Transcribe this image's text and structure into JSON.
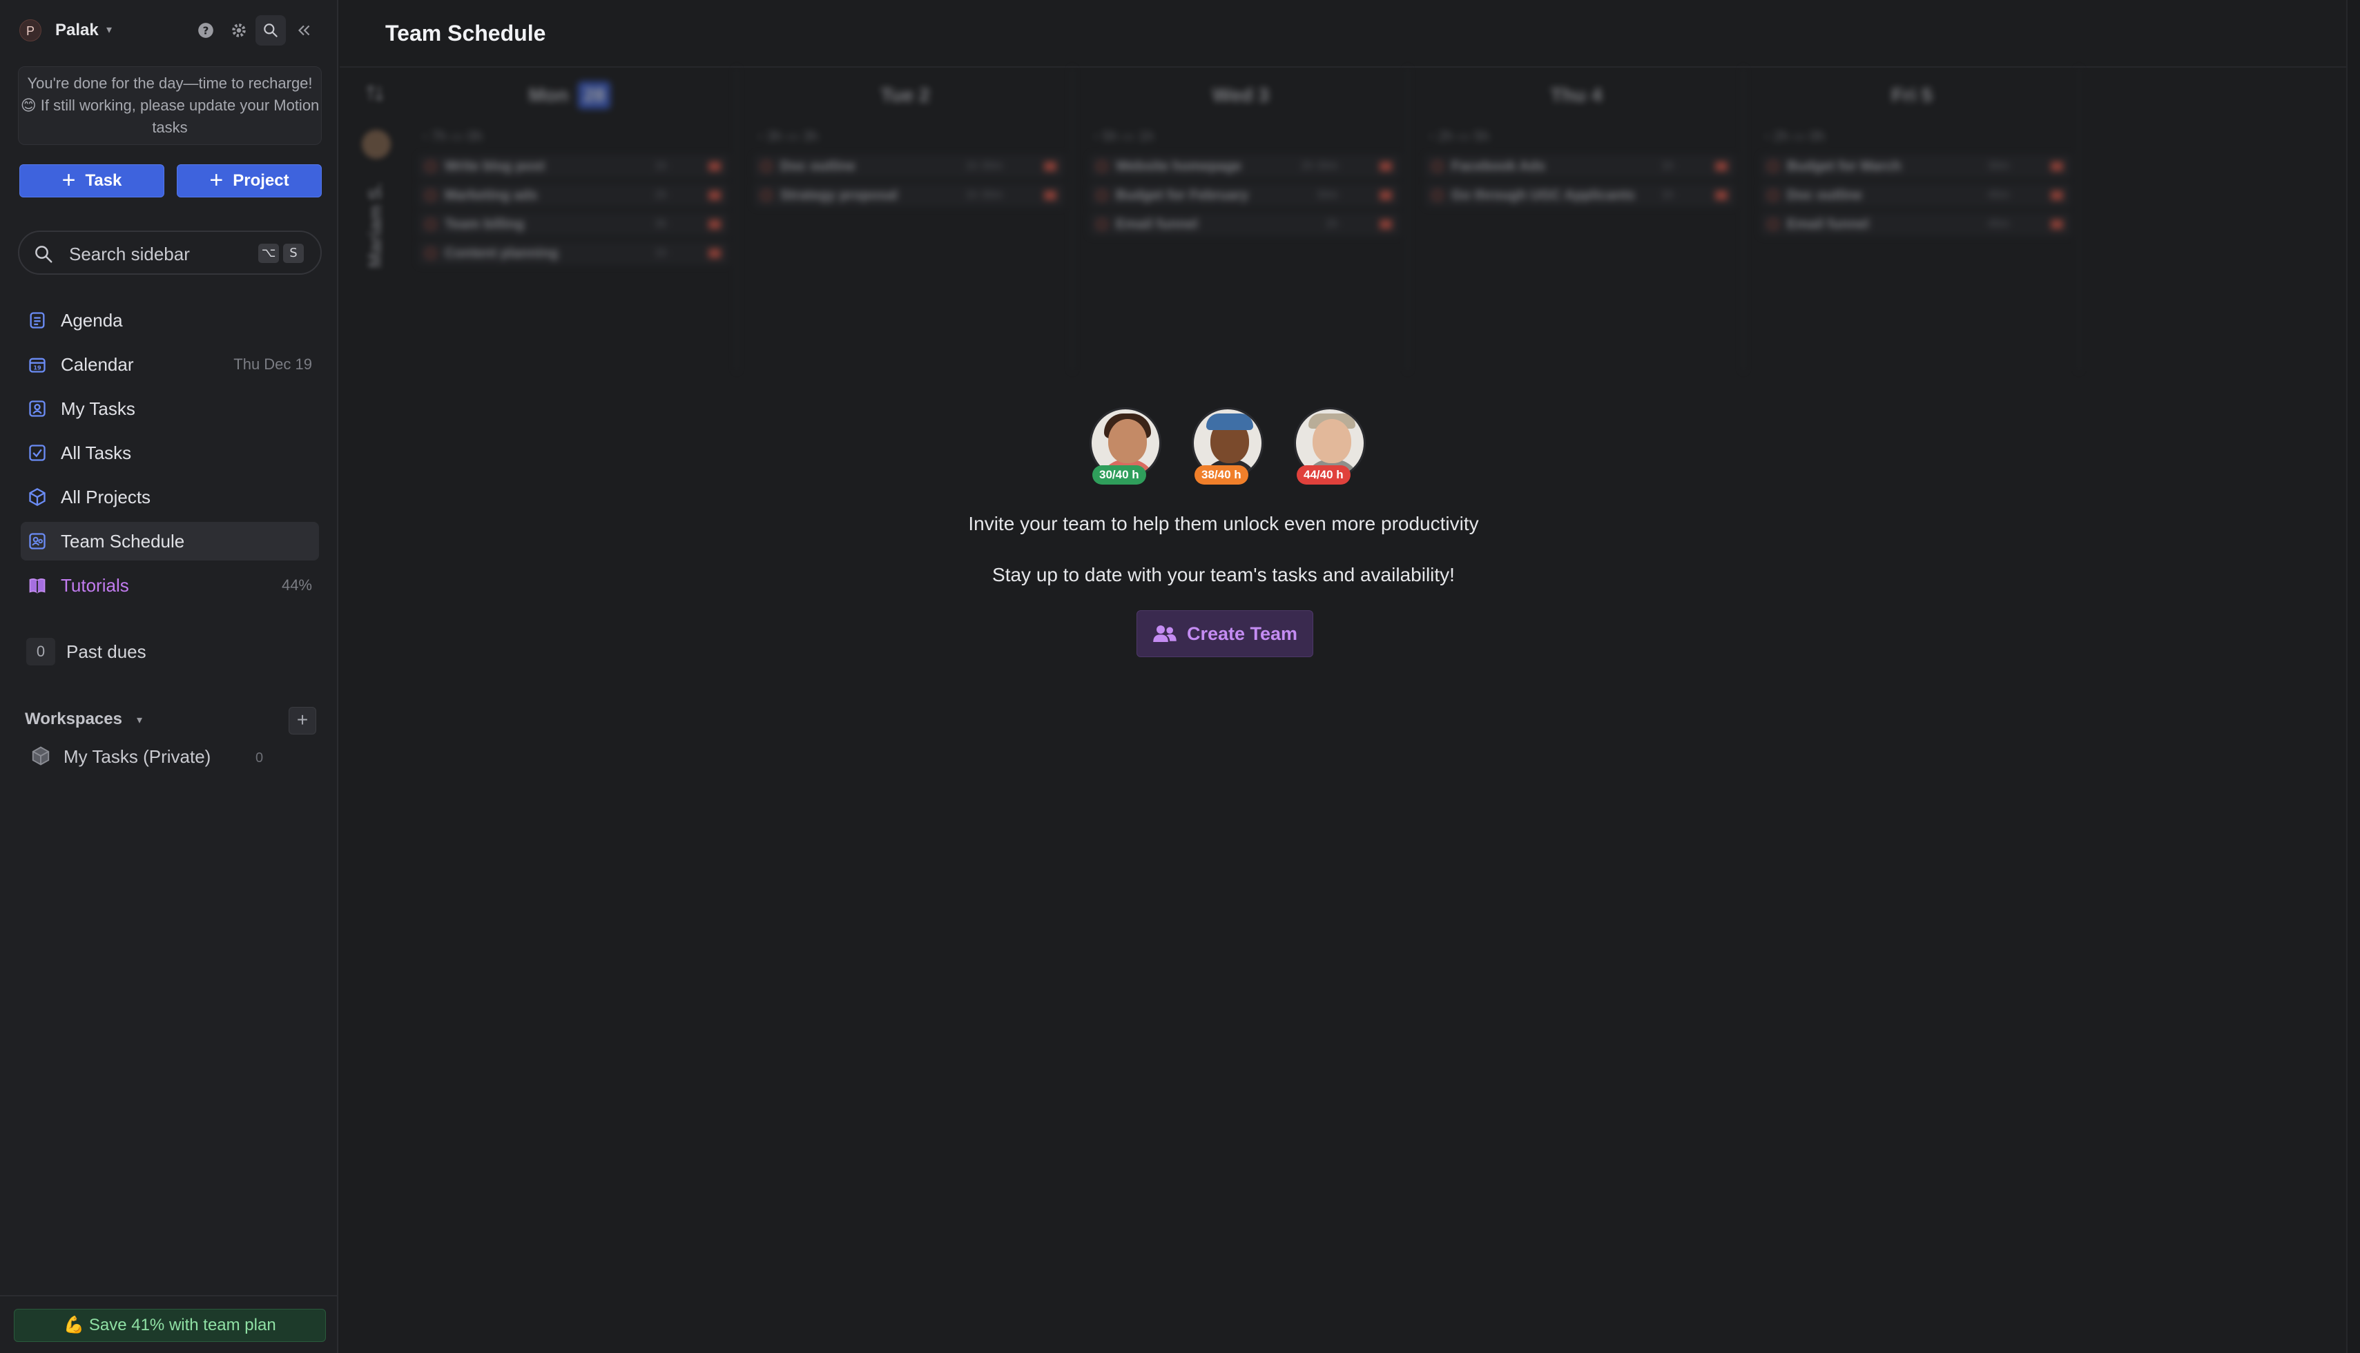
{
  "colors": {
    "accent": "#3e63dd",
    "purple": "#c48cf2",
    "green_badge": "#2f9e5b",
    "orange_badge": "#f07f2a",
    "red_badge": "#e0413c",
    "save_banner_text": "#8fe0a4"
  },
  "sidebar": {
    "workspace_initial": "P",
    "workspace_name": "Palak",
    "notice": "You're done for the day—time to recharge! 😊 If still working, please update your Motion tasks",
    "task_button": "Task",
    "project_button": "Project",
    "search": {
      "placeholder": "Search sidebar",
      "shortcut_1": "⌥",
      "shortcut_2": "S"
    },
    "nav": [
      {
        "label": "Agenda",
        "icon": "agenda-icon",
        "extra": ""
      },
      {
        "label": "Calendar",
        "icon": "calendar-icon",
        "extra": "Thu Dec 19"
      },
      {
        "label": "My Tasks",
        "icon": "user-tasks-icon",
        "extra": ""
      },
      {
        "label": "All Tasks",
        "icon": "checkbox-icon",
        "extra": ""
      },
      {
        "label": "All Projects",
        "icon": "cube-icon",
        "extra": ""
      },
      {
        "label": "Team Schedule",
        "icon": "team-schedule-icon",
        "extra": "",
        "active": true
      },
      {
        "label": "Tutorials",
        "icon": "book-icon",
        "extra": "44%"
      }
    ],
    "past_dues": {
      "count": "0",
      "label": "Past dues"
    },
    "workspaces": {
      "header": "Workspaces",
      "items": [
        {
          "label": "My Tasks (Private)",
          "count": "0"
        }
      ]
    },
    "save_banner": "💪 Save 41% with team plan"
  },
  "main": {
    "title": "Team Schedule",
    "person_name": "Mariam S.",
    "days": [
      {
        "day": "Mon",
        "date": "28",
        "today": true,
        "cap1": "7h",
        "cap2": "0h",
        "tasks": [
          {
            "name": "Write blog post",
            "dur": "1h"
          },
          {
            "name": "Marketing ads",
            "dur": "2h"
          },
          {
            "name": "Team billing",
            "dur": "3h"
          },
          {
            "name": "Content planning",
            "dur": "1h"
          }
        ]
      },
      {
        "day": "Tue",
        "date": "2",
        "today": false,
        "cap1": "3h",
        "cap2": "3h",
        "tasks": [
          {
            "name": "Doc outline",
            "dur": "1h 30m"
          },
          {
            "name": "Strategy proposal",
            "dur": "1h 30m"
          }
        ]
      },
      {
        "day": "Wed",
        "date": "3",
        "today": false,
        "cap1": "5h",
        "cap2": "1h",
        "tasks": [
          {
            "name": "Website homepage",
            "dur": "2h 30m"
          },
          {
            "name": "Budget for February",
            "dur": "30m"
          },
          {
            "name": "Email funnel",
            "dur": "2h"
          }
        ]
      },
      {
        "day": "Thu",
        "date": "4",
        "today": false,
        "cap1": "2h",
        "cap2": "5h",
        "tasks": [
          {
            "name": "Facebook Ads",
            "dur": "1h"
          },
          {
            "name": "Go through UGC Applicants",
            "dur": "1h"
          }
        ]
      },
      {
        "day": "Fri",
        "date": "5",
        "today": false,
        "cap1": "2h",
        "cap2": "0h",
        "tasks": [
          {
            "name": "Budget for March",
            "dur": "30m"
          },
          {
            "name": "Doc outline",
            "dur": "45m"
          },
          {
            "name": "Email funnel",
            "dur": "45m"
          }
        ]
      }
    ],
    "empty_state": {
      "avatars": [
        {
          "badge": "30/40 h",
          "badge_color": "#2f9e5b"
        },
        {
          "badge": "38/40 h",
          "badge_color": "#f07f2a"
        },
        {
          "badge": "44/40 h",
          "badge_color": "#e0413c"
        }
      ],
      "title": "Invite your team to help them unlock even more productivity",
      "subtitle": "Stay up to date with your team's tasks and availability!",
      "button": "Create Team"
    }
  }
}
